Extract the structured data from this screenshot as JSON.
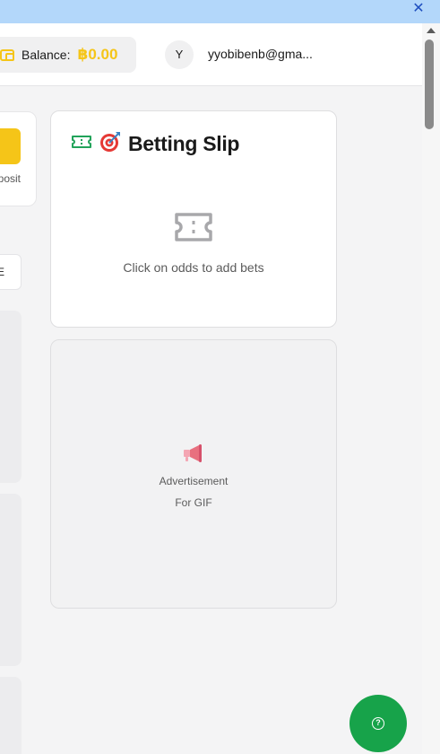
{
  "window": {
    "close_glyph": "✕"
  },
  "header": {
    "balance_label": "Balance:",
    "balance_amount": "฿0.00",
    "avatar_initial": "Y",
    "email": "yyobibenb@gma..."
  },
  "left_column": {
    "deposit_label": "Deposit",
    "chip_label": "E"
  },
  "betting_slip": {
    "title": "Betting Slip",
    "title_emoji": "🎯",
    "empty_message": "Click on odds to add bets"
  },
  "advertisement": {
    "line1": "Advertisement",
    "line2": "For GIF"
  },
  "help": {
    "glyph": "?"
  },
  "colors": {
    "accent_yellow": "#f5c518",
    "ticket_green": "#22a35a",
    "help_green": "#17a34a",
    "topbar_blue": "#b3d7fa"
  },
  "icons": [
    "close-icon",
    "wallet-icon",
    "ticket-icon",
    "target-icon",
    "ticket-empty-icon",
    "megaphone-icon",
    "help-icon",
    "scroll-up-arrow-icon"
  ]
}
